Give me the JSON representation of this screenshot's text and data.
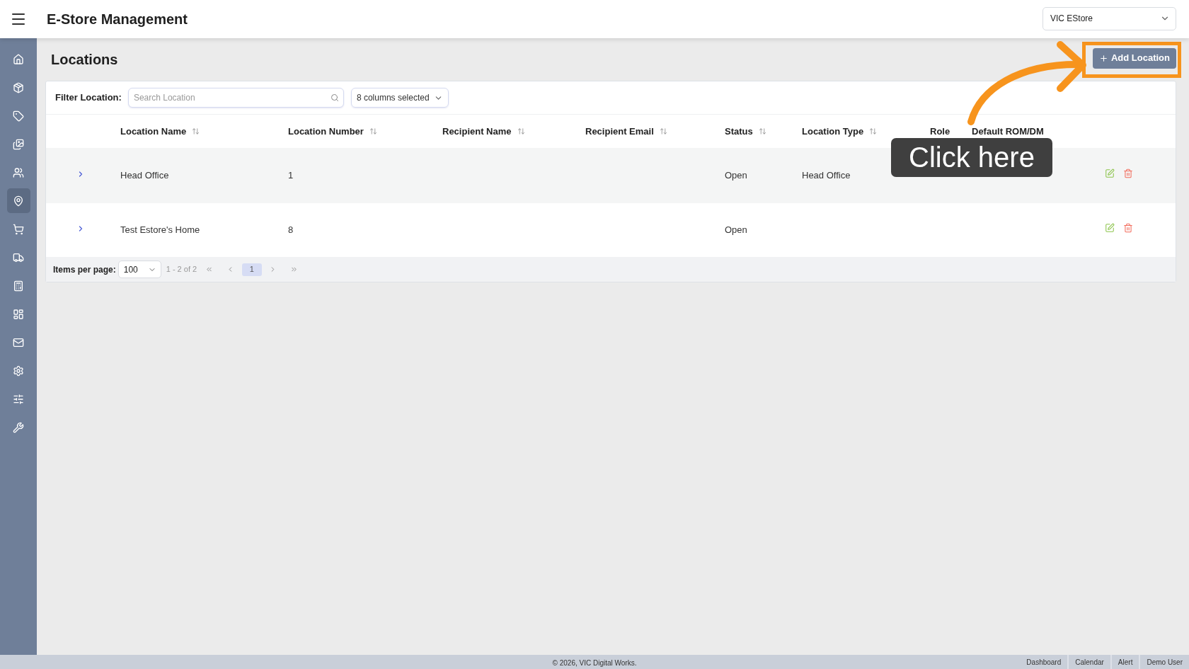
{
  "header": {
    "title": "E-Store Management",
    "store_select": {
      "value": "VIC EStore"
    }
  },
  "sidebar": {
    "items": [
      {
        "kind": "home",
        "selected": false
      },
      {
        "kind": "package",
        "selected": false
      },
      {
        "kind": "tag",
        "selected": false
      },
      {
        "kind": "images",
        "selected": false
      },
      {
        "kind": "users",
        "selected": false
      },
      {
        "kind": "location",
        "selected": true
      },
      {
        "kind": "cart",
        "selected": false
      },
      {
        "kind": "truck",
        "selected": false
      },
      {
        "kind": "calculator",
        "selected": false
      },
      {
        "kind": "dashboard",
        "selected": false
      },
      {
        "kind": "mail",
        "selected": false
      },
      {
        "kind": "settings",
        "selected": false
      },
      {
        "kind": "sliders",
        "selected": false
      },
      {
        "kind": "wrench",
        "selected": false
      }
    ]
  },
  "page": {
    "title": "Locations",
    "add_button": {
      "label": "Add Location"
    }
  },
  "filter": {
    "label": "Filter Location:",
    "search": {
      "placeholder": "Search Location"
    },
    "columns_select": {
      "value": "8 columns selected"
    }
  },
  "table": {
    "columns": [
      {
        "label": "Location Name",
        "sortable": true
      },
      {
        "label": "Location Number",
        "sortable": true
      },
      {
        "label": "Recipient Name",
        "sortable": true
      },
      {
        "label": "Recipient Email",
        "sortable": true
      },
      {
        "label": "Status",
        "sortable": true
      },
      {
        "label": "Location Type",
        "sortable": true
      },
      {
        "label": "Role",
        "sortable": false
      },
      {
        "label": "Default ROM/DM",
        "sortable": false
      }
    ],
    "rows": [
      {
        "expanded": false,
        "location_name": "Head Office",
        "location_number": "1",
        "status": "Open",
        "location_type": "Head Office"
      },
      {
        "expanded": false,
        "location_name": "Test Estore's Home",
        "location_number": "8",
        "status": "Open"
      }
    ]
  },
  "pagination": {
    "label": "Items per page:",
    "page_size": "100",
    "range": "1 - 2 of 2",
    "pages": [
      {
        "label": "1",
        "selected": true
      }
    ]
  },
  "footer": {
    "copyright": "© 2026, VIC Digital Works.",
    "links": [
      "Dashboard",
      "Calendar",
      "Alert",
      "Demo User"
    ]
  },
  "annotation": {
    "callout": "Click here"
  }
}
